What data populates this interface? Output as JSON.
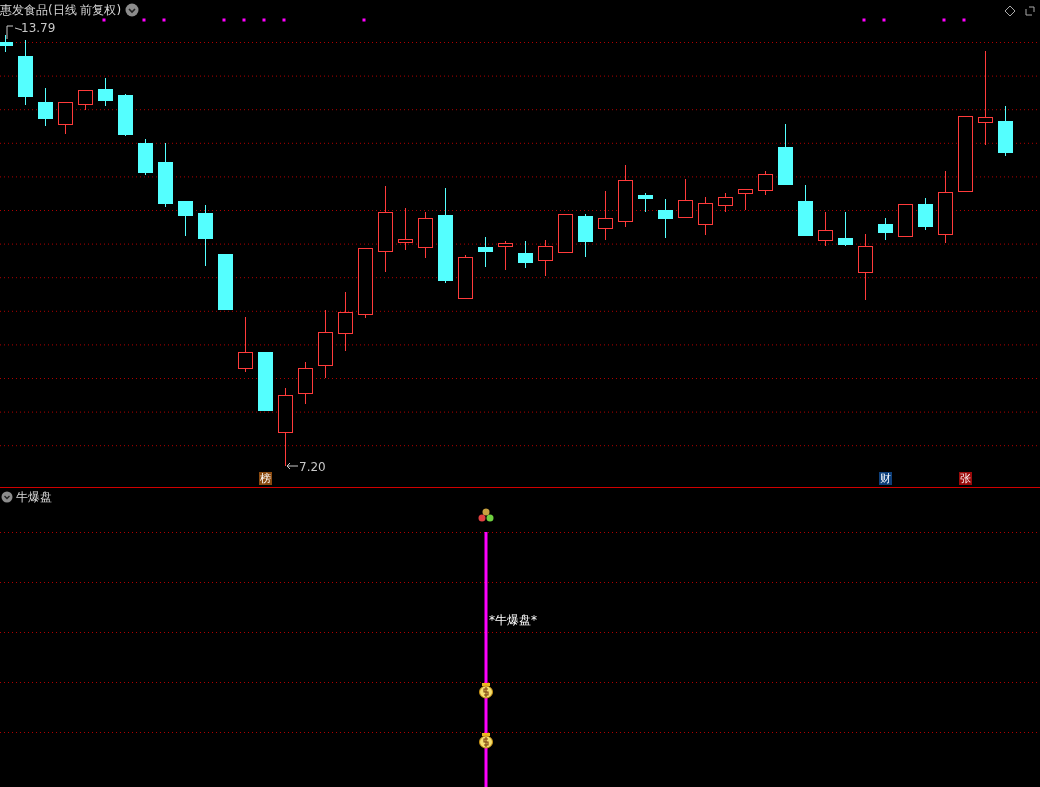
{
  "main_panel": {
    "title": "惠发食品(日线 前复权)",
    "high_label": "13.79",
    "low_label": "7.20",
    "markers": [
      {
        "text": "榜",
        "color": "#8a4a10"
      },
      {
        "text": "财",
        "color": "#0e3f7a"
      },
      {
        "text": "张",
        "color": "#9a0a0a"
      }
    ]
  },
  "indicator_panel": {
    "title": "牛爆盘",
    "signal_label": "*牛爆盘*"
  }
}
